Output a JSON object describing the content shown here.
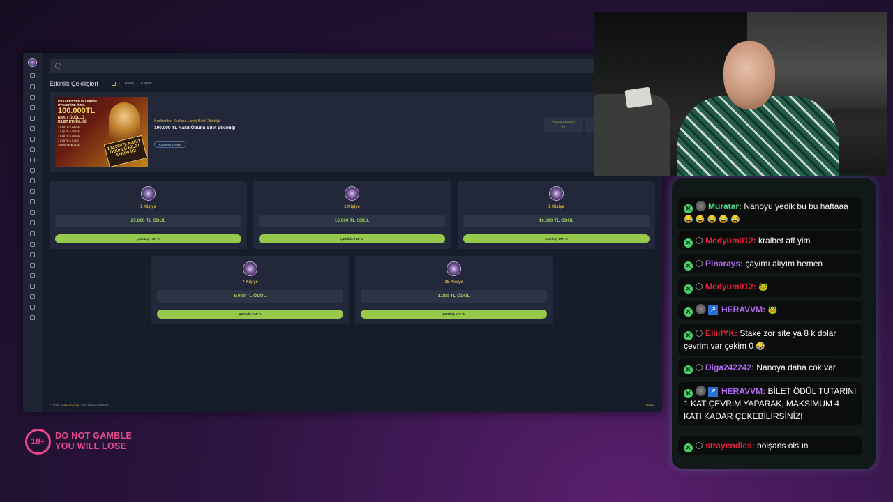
{
  "app": {
    "page_title": "Etkinlik Çekilişleri",
    "breadcrumb": [
      "Listele",
      "Çekiliş"
    ],
    "hero": {
      "banner": {
        "line1": "KRALBET'TEN VALERIVM",
        "line2": "ÜYELERİNE ÖZEL",
        "amount": "100.000TL",
        "line3": "NAKİT ÖDÜLLÜ",
        "line4": "BİLET ETKİNLİĞİ",
        "rows": [
          "1 KİŞİYE ₺ 25.000",
          "1 KİŞİYE ₺ 15.000",
          "1 KİŞİYE ₺ 10.000",
          "7 KİŞİYE ₺ 5.000",
          "15 KİŞİYE ₺ 1.000"
        ],
        "stamp": "100.000TL NAKİT ÖDÜLLÜ BİLET ETKİNLİĞİ"
      },
      "subtitle": "Kralbet'ten Krallara Layık Bilet Etkinliği!",
      "title": "100.000 TL Nakit Ödüllü Bilet Etkinliği",
      "participants_button": "Katılımcı Listesi",
      "stat_label": "Toplam Katılımcı",
      "stat_value": "47",
      "stat2_label": "To"
    },
    "cards": [
      {
        "count": "1 Kişiye",
        "prize": "25.000 TL ÖDÜL",
        "button": "ÇEKİLİŞ YAP ↻"
      },
      {
        "count": "1 Kişiye",
        "prize": "15.000 TL ÖDÜL",
        "button": "ÇEKİLİŞ YAP ↻"
      },
      {
        "count": "1 Kişiye",
        "prize": "10.000 TL ÖDÜL",
        "button": "ÇEKİLİŞ YAP ↻"
      },
      {
        "count": "7 Kişiye",
        "prize": "5.000 TL ÖDÜL",
        "button": "ÇEKİLİŞ YAP ↻"
      },
      {
        "count": "15 Kişiye",
        "prize": "1.000 TL ÖDÜL",
        "button": "ÇEKİLİŞ YAP ↻"
      }
    ],
    "footer": {
      "copy": "© 2025",
      "brand": "valerivm.com",
      "rights": ", Tüm hakları Saklıdır.",
      "right": "Valeri"
    }
  },
  "chat": {
    "messages": [
      {
        "user": "Muratar",
        "color": "#4fe08c",
        "text": "Nanoyu yedik bu bu haftaaa",
        "emotes": "😂 😂 😂 😂 😂"
      },
      {
        "user": "Medyum012",
        "color": "#e0253c",
        "text": "kralbet aff yim"
      },
      {
        "user": "Pinarays",
        "color": "#b06cf0",
        "text": "çayımı alıyım hemen"
      },
      {
        "user": "Medyum012",
        "color": "#e0253c",
        "text": "",
        "emotes": "🐸"
      },
      {
        "user": "HERAVVM",
        "color": "#b06cf0",
        "text": "",
        "emotes": "🐸"
      },
      {
        "user": "EliiifYK",
        "color": "#e0253c",
        "text": "Stake zor site ya 8 k dolar çevrim var çekim 0",
        "emotes": "🤣"
      },
      {
        "user": "Diga242242",
        "color": "#b06cf0",
        "text": "Nanoya daha cok var"
      },
      {
        "user": "HERAVVM",
        "color": "#b06cf0",
        "text": "BİLET ÖDÜL TUTARINI 1 KAT ÇEVRİM YAPARAK, MAKSİMUM 4 KATI KADAR ÇEKEBİLİRSİNİZ!"
      },
      {
        "user": "strayendles",
        "color": "#e0253c",
        "text": "bolşans olsun"
      }
    ]
  },
  "warning": {
    "age": "18+",
    "line1": "DO NOT GAMBLE",
    "line2": "YOU WILL LOSE"
  },
  "colors": {
    "accent_gold": "#d8b23f",
    "accent_green": "#95c84b",
    "warning_pink": "#e64a8a"
  }
}
